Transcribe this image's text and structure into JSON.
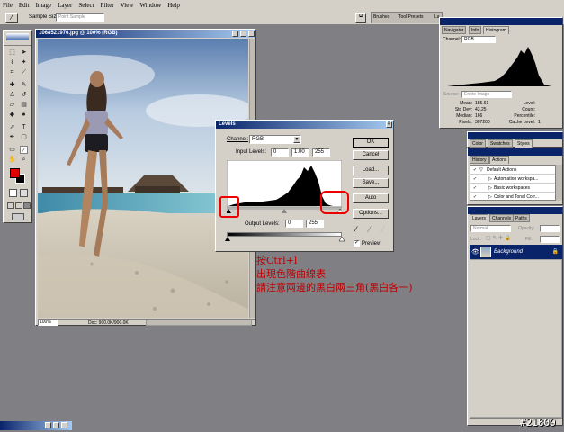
{
  "menu": [
    "File",
    "Edit",
    "Image",
    "Layer",
    "Select",
    "Filter",
    "View",
    "Window",
    "Help"
  ],
  "options": {
    "sample_size_label": "Sample Size:",
    "sample_size_value": "Point Sample"
  },
  "palette_well": {
    "tabs": [
      "Brushes",
      "Tool Presets",
      "La"
    ]
  },
  "document": {
    "title": "1068521976.jpg @ 100% (RGB)",
    "zoom": "100%",
    "doc_info": "Doc: 900.0K/900.0K"
  },
  "navigator": {
    "tabs": [
      "Navigator",
      "Info",
      "Histogram"
    ],
    "channel_label": "Channel:",
    "channel_value": "RGB",
    "source_label": "Source:",
    "source_value": "Entire Image",
    "stats_left": [
      {
        "label": "Mean:",
        "value": "155.61"
      },
      {
        "label": "Std Dev:",
        "value": "43.25"
      },
      {
        "label": "Median:",
        "value": "166"
      },
      {
        "label": "Pixels:",
        "value": "307200"
      }
    ],
    "stats_right": [
      {
        "label": "Level:",
        "value": ""
      },
      {
        "label": "Count:",
        "value": ""
      },
      {
        "label": "Percentile:",
        "value": ""
      },
      {
        "label": "Cache Level:",
        "value": "1"
      }
    ]
  },
  "levels": {
    "title": "Levels",
    "channel_label": "Channel:",
    "channel_value": "RGB",
    "input_label": "Input Levels:",
    "input_values": [
      "0",
      "1.00",
      "255"
    ],
    "output_label": "Output Levels:",
    "output_values": [
      "0",
      "255"
    ],
    "buttons": [
      "OK",
      "Cancel",
      "Load...",
      "Save...",
      "Auto",
      "Options..."
    ],
    "preview_label": "Preview"
  },
  "color_panel": {
    "tabs": [
      "Color",
      "Swatches",
      "Styles"
    ]
  },
  "history_panel": {
    "tabs": [
      "History",
      "Actions"
    ],
    "items": [
      "Default Actions",
      "Automation workspa...",
      "Basic workspaces",
      "Color and Tonal Corr..."
    ]
  },
  "layers_panel": {
    "tabs": [
      "Layers",
      "Channels",
      "Paths"
    ],
    "blend_mode": "Normal",
    "opacity_label": "Opacity:",
    "lock_label": "Lock:",
    "fill_label": "Fill:",
    "layer_name": "Background"
  },
  "annotation": {
    "lines": [
      "按Ctrl+l",
      "出現色階曲線表",
      "請注意兩邊的黑白兩三角(黑白各一)"
    ]
  },
  "watermark": "#21809",
  "colors": {
    "titlebar": "#0a246a",
    "annotation_red": "#c00000",
    "foreground": "#e00000",
    "background": "#000000"
  }
}
